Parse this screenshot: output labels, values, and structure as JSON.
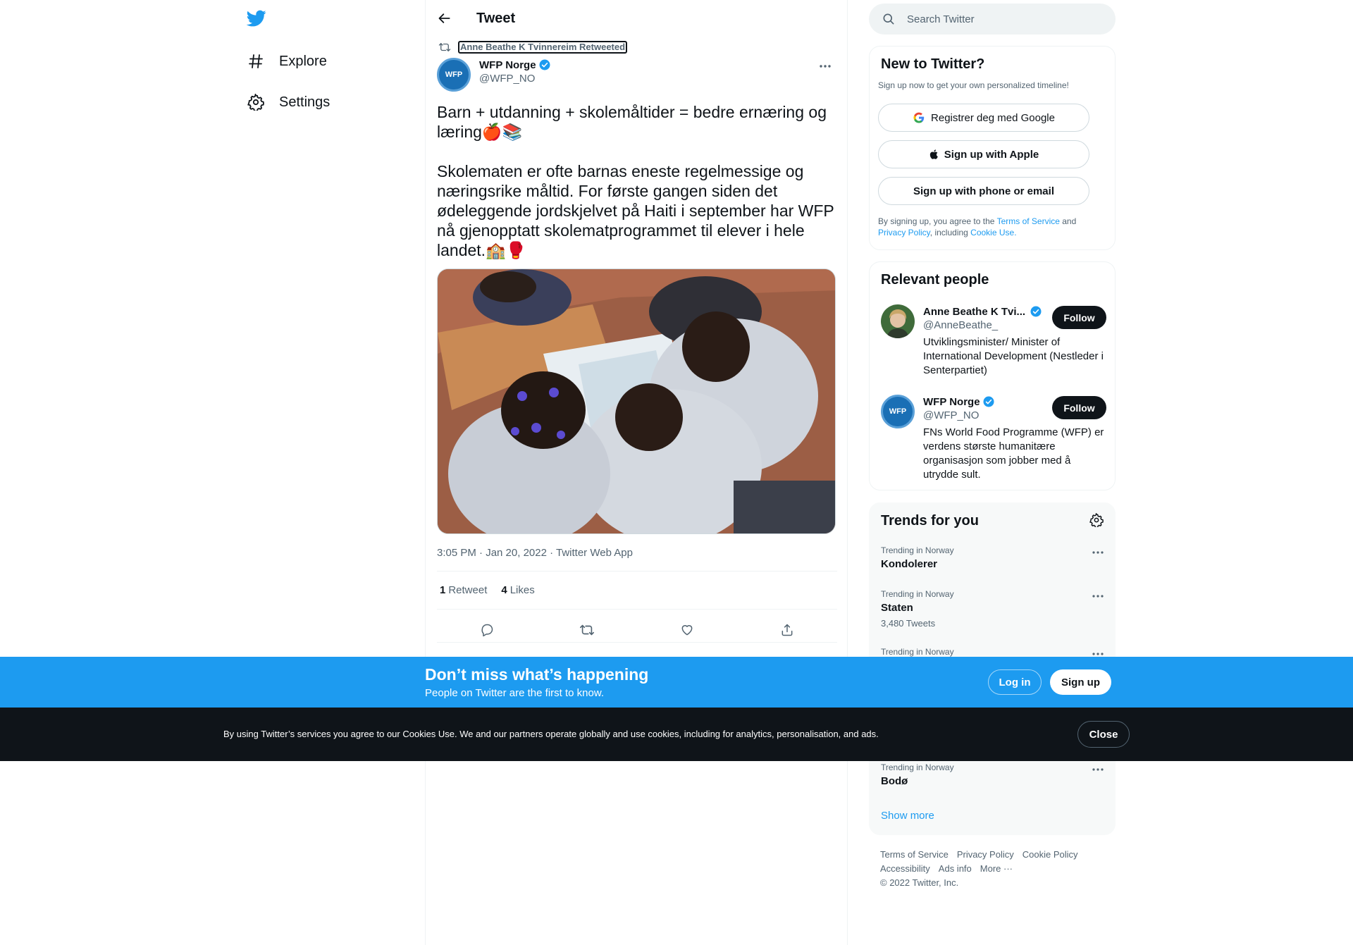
{
  "nav": {
    "items": [
      {
        "label": "Explore",
        "icon": "hashtag-icon"
      },
      {
        "label": "Settings",
        "icon": "gear-icon"
      }
    ]
  },
  "header": {
    "title": "Tweet"
  },
  "tweet": {
    "retweet_context": "Anne Beathe K Tvinnereim Retweeted",
    "author_name": "WFP Norge",
    "author_handle": "@WFP_NO",
    "avatar_text": "WFP",
    "text_line1": "Barn + utdanning + skolemåltider = bedre ernæring og læring🍎📚",
    "text_line2": "Skolematen er ofte barnas eneste regelmessige og næringsrike måltid. For første gangen siden det ødeleggende jordskjelvet på Haiti i september har WFP nå gjenopptatt skolematprogrammet  til elever i hele landet.🏫🥊",
    "timestamp": "3:05 PM · Jan 20, 2022 · ",
    "source": "Twitter Web App",
    "retweets_count": "1",
    "retweets_label": "Retweet",
    "likes_count": "4",
    "likes_label": "Likes"
  },
  "search": {
    "placeholder": "Search Twitter"
  },
  "new_to_twitter": {
    "title": "New to Twitter?",
    "subtitle": "Sign up now to get your own personalized timeline!",
    "google_label": "Registrer deg med Google",
    "apple_label": "Sign up with Apple",
    "phone_label": "Sign up with phone or email",
    "legal_prefix": "By signing up, you agree to the ",
    "terms": "Terms of Service",
    "and": " and ",
    "privacy": "Privacy Policy",
    "including": ", including ",
    "cookie": "Cookie Use."
  },
  "relevant_people": {
    "title": "Relevant people",
    "people": [
      {
        "name": "Anne Beathe K Tvi...",
        "handle": "@AnneBeathe_",
        "bio": "Utviklingsminister/ Minister of International Development (Nestleder i Senterpartiet)",
        "follow": "Follow"
      },
      {
        "name": "WFP Norge",
        "handle": "@WFP_NO",
        "bio": "FNs World Food Programme (WFP) er verdens største humanitære organisasjon som jobber med å utrydde sult.",
        "follow": "Follow",
        "avatar_text": "WFP"
      }
    ]
  },
  "trends": {
    "title": "Trends for you",
    "items": [
      {
        "context": "Trending in Norway",
        "name": "Kondolerer",
        "count": ""
      },
      {
        "context": "Trending in Norway",
        "name": "Staten",
        "count": "3,480 Tweets"
      },
      {
        "context": "Trending in Norway",
        "name": "",
        "count": ""
      },
      {
        "context": "Trending in Norway",
        "name": "Bodø",
        "count": ""
      }
    ],
    "show_more": "Show more"
  },
  "footer": {
    "links": [
      "Terms of Service",
      "Privacy Policy",
      "Cookie Policy",
      "Accessibility",
      "Ads info",
      "More ···"
    ],
    "copyright": "© 2022 Twitter, Inc."
  },
  "signup_bar": {
    "title": "Don’t miss what’s happening",
    "subtitle": "People on Twitter are the first to know.",
    "login": "Log in",
    "signup": "Sign up"
  },
  "cookie_bar": {
    "text": "By using Twitter’s services you agree to our Cookies Use. We and our partners operate globally and use cookies, including for analytics, personalisation, and ads.",
    "close": "Close"
  },
  "colors": {
    "accent": "#1d9bf0",
    "text": "#0f1419",
    "secondary": "#536471",
    "cookie_bg": "#0f1419"
  }
}
